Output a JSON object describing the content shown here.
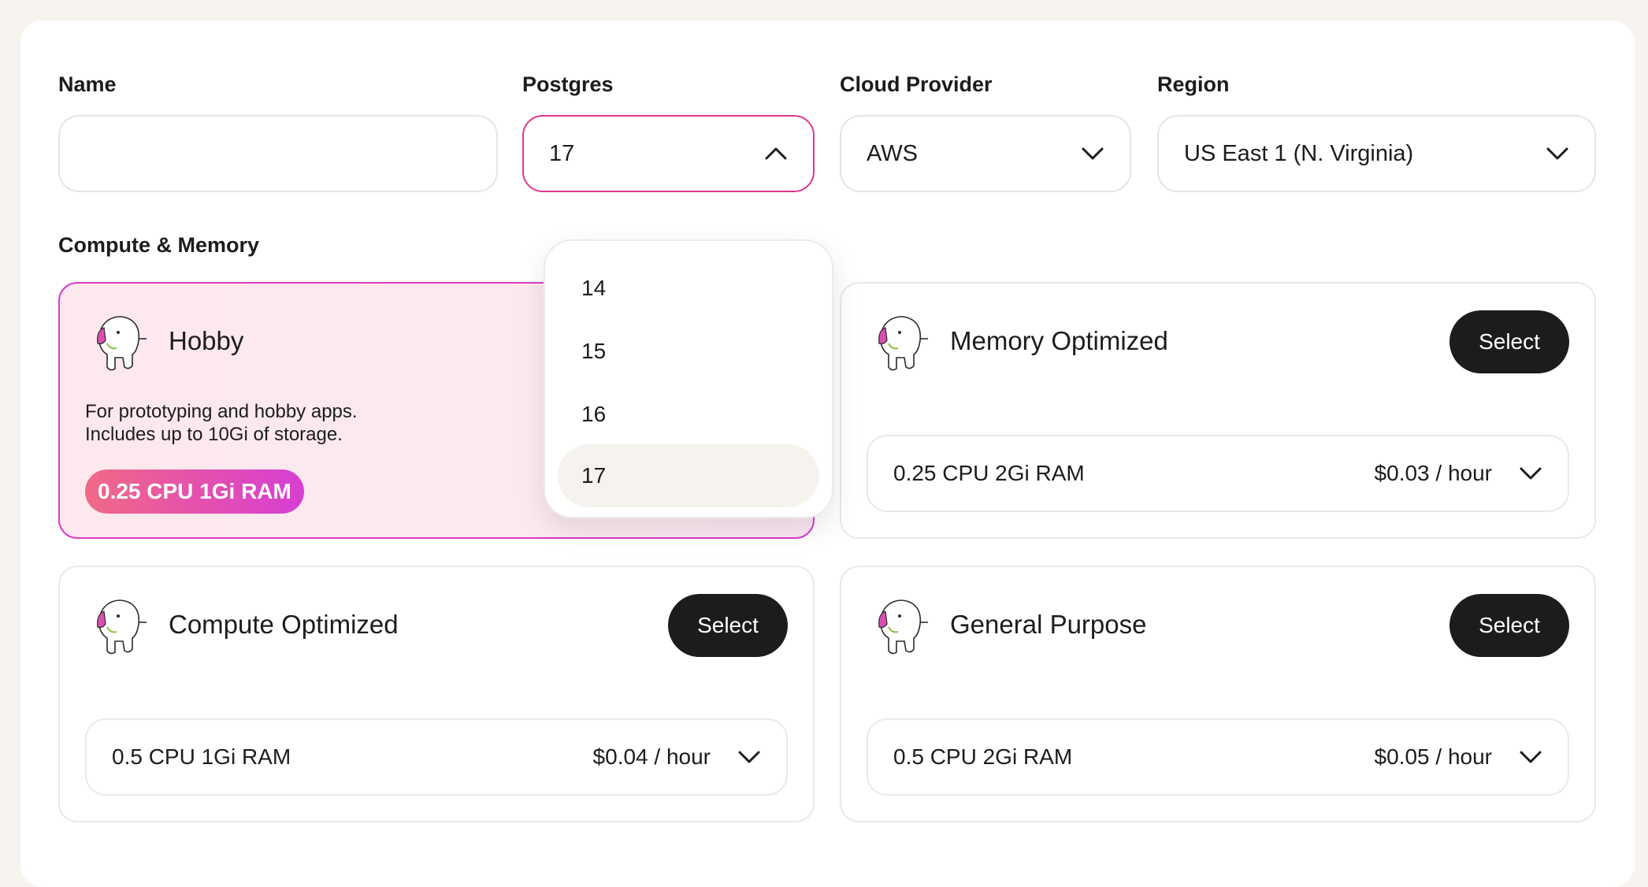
{
  "form": {
    "name": {
      "label": "Name",
      "value": ""
    },
    "postgres": {
      "label": "Postgres",
      "value": "17",
      "options": [
        "14",
        "15",
        "16",
        "17"
      ]
    },
    "cloud_provider": {
      "label": "Cloud Provider",
      "value": "AWS"
    },
    "region": {
      "label": "Region",
      "value": "US East 1 (N. Virginia)"
    }
  },
  "compute": {
    "heading": "Compute & Memory",
    "tiers": [
      {
        "title": "Hobby",
        "selected": true,
        "description_line1": "For prototyping and hobby apps.",
        "description_line2": "Includes up to 10Gi of storage.",
        "badge": "0.25 CPU 1Gi RAM"
      },
      {
        "title": "Memory Optimized",
        "button": "Select",
        "spec": "0.25 CPU 2Gi RAM",
        "price": "$0.03 / hour"
      },
      {
        "title": "Compute Optimized",
        "button": "Select",
        "spec": "0.5 CPU 1Gi RAM",
        "price": "$0.04 / hour"
      },
      {
        "title": "General Purpose",
        "button": "Select",
        "spec": "0.5 CPU 2Gi RAM",
        "price": "$0.05 / hour"
      }
    ]
  },
  "colors": {
    "accent": "#e0368c",
    "button": "#1c1c1c",
    "background": "#f7f3ef"
  },
  "icons": [
    "chevron-down-icon",
    "chevron-up-icon",
    "elephant-mascot-icon"
  ]
}
